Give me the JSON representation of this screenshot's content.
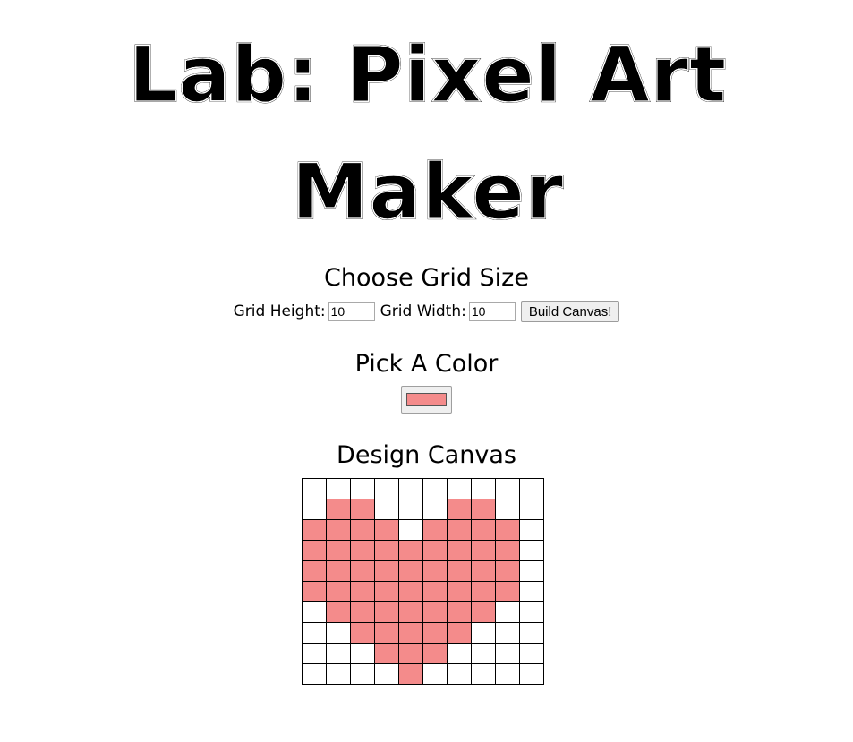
{
  "title": {
    "line1": "Lab: Pixel Art",
    "line2": "Maker"
  },
  "grid_size": {
    "heading": "Choose Grid Size",
    "height_label": "Grid Height:",
    "height_value": "10",
    "width_label": "Grid Width:",
    "width_value": "10",
    "submit_label": "Build Canvas!"
  },
  "color": {
    "heading": "Pick A Color",
    "value": "#f48b8b"
  },
  "canvas": {
    "heading": "Design Canvas",
    "rows": 10,
    "cols": 10,
    "empty_color": "#ffffff",
    "fill_color": "#f48b8b",
    "cells": [
      [
        0,
        0,
        0,
        0,
        0,
        0,
        0,
        0,
        0,
        0
      ],
      [
        0,
        1,
        1,
        0,
        0,
        0,
        1,
        1,
        0,
        0
      ],
      [
        1,
        1,
        1,
        1,
        0,
        1,
        1,
        1,
        1,
        0
      ],
      [
        1,
        1,
        1,
        1,
        1,
        1,
        1,
        1,
        1,
        0
      ],
      [
        1,
        1,
        1,
        1,
        1,
        1,
        1,
        1,
        1,
        0
      ],
      [
        1,
        1,
        1,
        1,
        1,
        1,
        1,
        1,
        1,
        0
      ],
      [
        0,
        1,
        1,
        1,
        1,
        1,
        1,
        1,
        0,
        0
      ],
      [
        0,
        0,
        1,
        1,
        1,
        1,
        1,
        0,
        0,
        0
      ],
      [
        0,
        0,
        0,
        1,
        1,
        1,
        0,
        0,
        0,
        0
      ],
      [
        0,
        0,
        0,
        0,
        1,
        0,
        0,
        0,
        0,
        0
      ]
    ]
  }
}
